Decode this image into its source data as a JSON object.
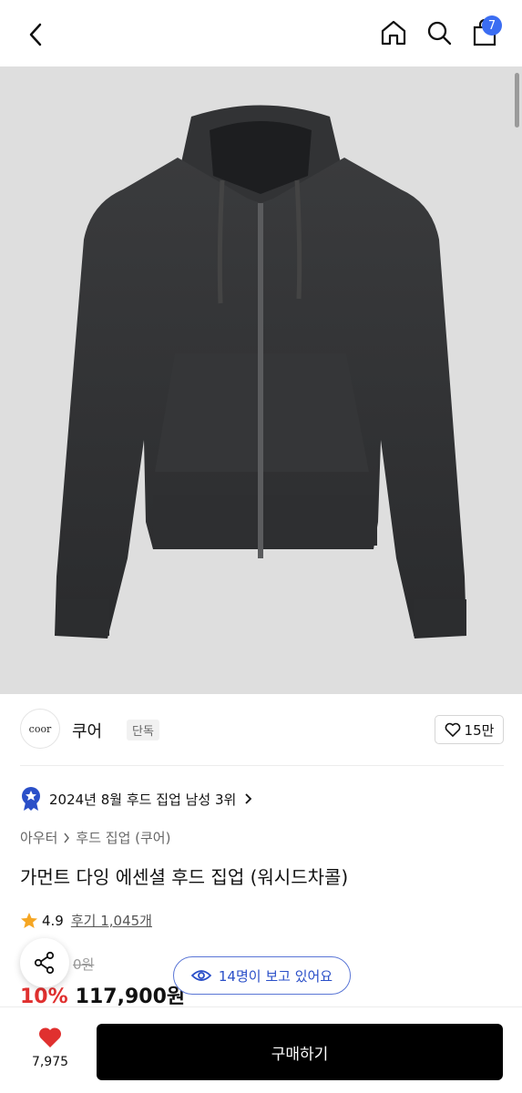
{
  "header": {
    "cart_count": "7"
  },
  "brand": {
    "logo_text": "coor",
    "name": "쿠어",
    "tag": "단독",
    "likes": "15만"
  },
  "ranking": {
    "text": "2024년 8월 후드 집업 남성 3위"
  },
  "breadcrumb": {
    "level1": "아우터",
    "level2": "후드 집업 (쿠어)"
  },
  "product": {
    "title": "가먼트 다잉 에센셜 후드 집업 (워시드차콜)",
    "rating": "4.9",
    "reviews": "후기 1,045개",
    "original_price_partial": "0원",
    "discount": "10%",
    "price": "117,900원"
  },
  "viewers": {
    "text": "14명이 보고 있어요"
  },
  "bottom": {
    "wish_count": "7,975",
    "buy_label": "구매하기"
  },
  "colors": {
    "accent_blue": "#3b6df2",
    "discount_red": "#e0302f",
    "heart_red": "#e0302f"
  }
}
